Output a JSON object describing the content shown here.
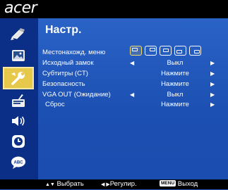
{
  "brand": {
    "logo": "acer"
  },
  "sidebar": {
    "items": [
      {
        "icon": "color-paint-icon",
        "selected": false
      },
      {
        "icon": "image-icon",
        "selected": false
      },
      {
        "icon": "wrench-icon",
        "selected": true
      },
      {
        "icon": "timer-icon",
        "selected": false
      },
      {
        "icon": "audio-icon",
        "selected": false
      },
      {
        "icon": "clock-icon",
        "selected": false
      },
      {
        "icon": "language-icon",
        "selected": false
      }
    ]
  },
  "menu": {
    "title": "Настр.",
    "rows": [
      {
        "label": "Местонахожд. меню",
        "value": "",
        "left_arrow": "",
        "right_arrow": ""
      },
      {
        "label": "Исходный замок",
        "value": "Выкл",
        "left_arrow": "◀",
        "right_arrow": "▶"
      },
      {
        "label": "Субтитры (CT)",
        "value": "Нажмите",
        "left_arrow": "",
        "right_arrow": "▶"
      },
      {
        "label": "Безопасность",
        "value": "Нажмите",
        "left_arrow": "",
        "right_arrow": "▶"
      },
      {
        "label": "VGA OUT (Ожидание)",
        "value": "Выкл",
        "left_arrow": "◀",
        "right_arrow": "▶"
      },
      {
        "label": "Сброс",
        "value": "Нажмите",
        "left_arrow": "",
        "right_arrow": "▶"
      }
    ],
    "location_selected_index": 0
  },
  "footer": {
    "select_keys": "▲▼",
    "select_label": "Выбрать",
    "adjust_keys": "◀ ▶",
    "adjust_label": "Регулир.",
    "menu_key": "MENU",
    "exit_label": "Выход"
  },
  "colors": {
    "panel": "#1d50b3",
    "sidebar": "#0b2f86",
    "highlight": "#e6c84a"
  }
}
